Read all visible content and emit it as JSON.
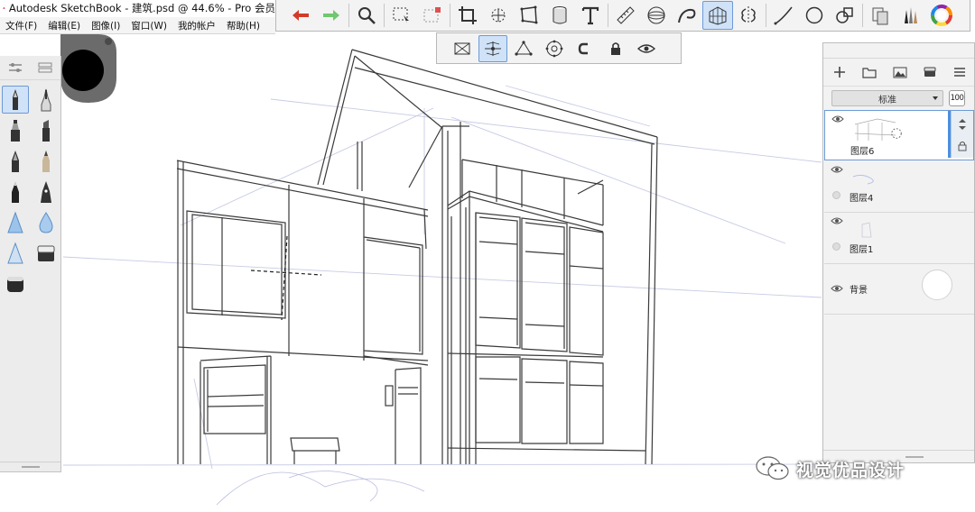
{
  "window": {
    "title": "Autodesk SketchBook - 建筑.psd @ 44.6% - Pro 会员"
  },
  "menu": [
    {
      "label": "文件(F)"
    },
    {
      "label": "编辑(E)"
    },
    {
      "label": "图像(I)"
    },
    {
      "label": "窗口(W)"
    },
    {
      "label": "我的帐户"
    },
    {
      "label": "帮助(H)"
    }
  ],
  "toolbar": {
    "items": [
      "undo-icon",
      "redo-icon",
      "zoom-icon",
      "select-icon",
      "crop-select-icon",
      "crop-icon",
      "transform-icon",
      "distort-icon",
      "fill-icon",
      "text-icon",
      "ruler-icon",
      "ellipse-guide-icon",
      "french-curve-icon",
      "perspective-grid-icon",
      "symmetry-icon",
      "stroke-icon",
      "circle-shape-icon",
      "shape-icon",
      "copy-paste-icon",
      "brush-library-icon",
      "color-wheel-icon"
    ],
    "active": "perspective-grid-icon"
  },
  "perspective_toolbar": {
    "items": [
      "one-point-perspective-icon",
      "two-point-perspective-icon",
      "three-point-perspective-icon",
      "fisheye-perspective-icon",
      "magnet-icon",
      "lock-icon",
      "visibility-eye-icon"
    ],
    "active": "two-point-perspective-icon"
  },
  "brushes": {
    "items": [
      "pencil",
      "technical-pen",
      "marker",
      "chisel-marker",
      "ballpoint-pen",
      "soft-pencil",
      "ink-pen",
      "calligraphy-pen",
      "airbrush",
      "water-drop",
      "smudge",
      "eraser-hard",
      "eraser-soft"
    ],
    "active": "pencil"
  },
  "layers": {
    "blend_mode": "标准",
    "opacity": "100",
    "items": [
      {
        "name": "图层6",
        "active": true
      },
      {
        "name": "图层4",
        "active": false
      },
      {
        "name": "图层1",
        "active": false
      },
      {
        "name": "背景",
        "active": false
      }
    ]
  },
  "watermark": {
    "text": "视觉优品设计"
  },
  "colors": {
    "accent": "#4a90e2",
    "active_bg": "#cfe2f7",
    "panel_bg": "#ececec",
    "undo_red": "#d23b2a",
    "redo_green": "#6ec86e"
  }
}
